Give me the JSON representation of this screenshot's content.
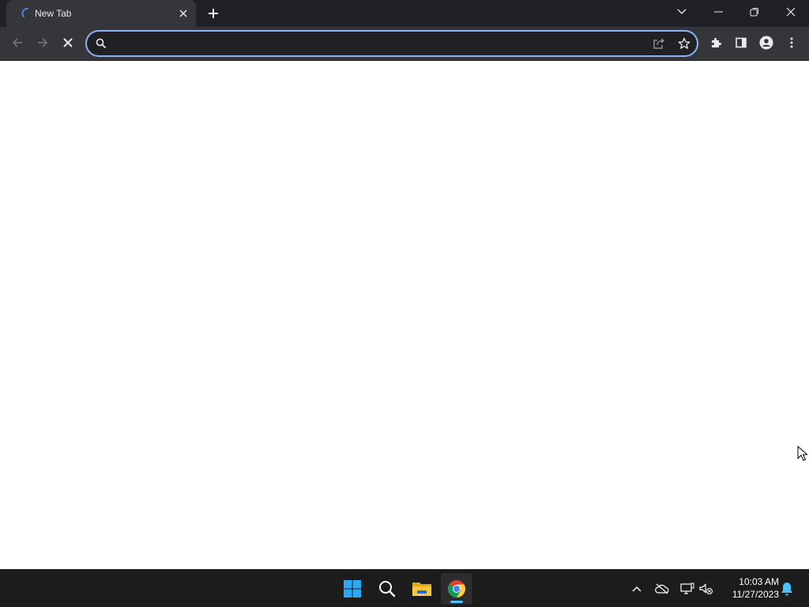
{
  "browser": {
    "tab": {
      "title": "New Tab"
    },
    "omnibox": {
      "value": "",
      "placeholder": ""
    }
  },
  "taskbar": {
    "clock": {
      "time": "10:03 AM",
      "date": "11/27/2023"
    }
  },
  "colors": {
    "titlebar": "#202124",
    "toolbar": "#35363a",
    "omnibox_focus_ring": "#8ab4f8",
    "taskbar": "#1c1c1c",
    "accent": "#4cc2ff"
  },
  "icons": [
    "loading-spinner-icon",
    "close-icon",
    "plus-icon",
    "chevron-down-icon",
    "minimize-icon",
    "restore-icon",
    "back-arrow-icon",
    "forward-arrow-icon",
    "stop-icon",
    "search-icon",
    "share-icon",
    "star-icon",
    "extensions-icon",
    "side-panel-icon",
    "profile-icon",
    "kebab-menu-icon",
    "windows-start-icon",
    "file-explorer-icon",
    "chrome-icon",
    "chevron-up-icon",
    "onedrive-icon",
    "network-icon",
    "volume-muted-icon",
    "bell-icon",
    "mouse-cursor-icon"
  ]
}
